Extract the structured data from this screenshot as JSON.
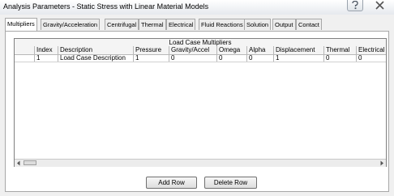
{
  "window": {
    "title": "Analysis Parameters - Static Stress with Linear Material Models",
    "help_icon": "help-icon",
    "close_icon": "close-icon"
  },
  "tabs": [
    {
      "label": "Multipliers",
      "active": true
    },
    {
      "label": "Gravity/Acceleration"
    },
    {
      "label": "Centrifugal"
    },
    {
      "label": "Thermal"
    },
    {
      "label": "Electrical"
    },
    {
      "label": "Fluid Reactions"
    },
    {
      "label": "Solution"
    },
    {
      "label": "Output"
    },
    {
      "label": "Contact"
    }
  ],
  "table": {
    "title": "Load Case Multipliers",
    "columns": [
      "Index",
      "Description",
      "Pressure",
      "Gravity/Accel",
      "Omega",
      "Alpha",
      "Displacement",
      "Thermal",
      "Electrical"
    ],
    "rows": [
      [
        "1",
        "Load Case Description",
        "1",
        "0",
        "0",
        "0",
        "1",
        "0",
        "0"
      ]
    ]
  },
  "buttons": {
    "add_row": "Add Row",
    "delete_row": "Delete Row"
  }
}
